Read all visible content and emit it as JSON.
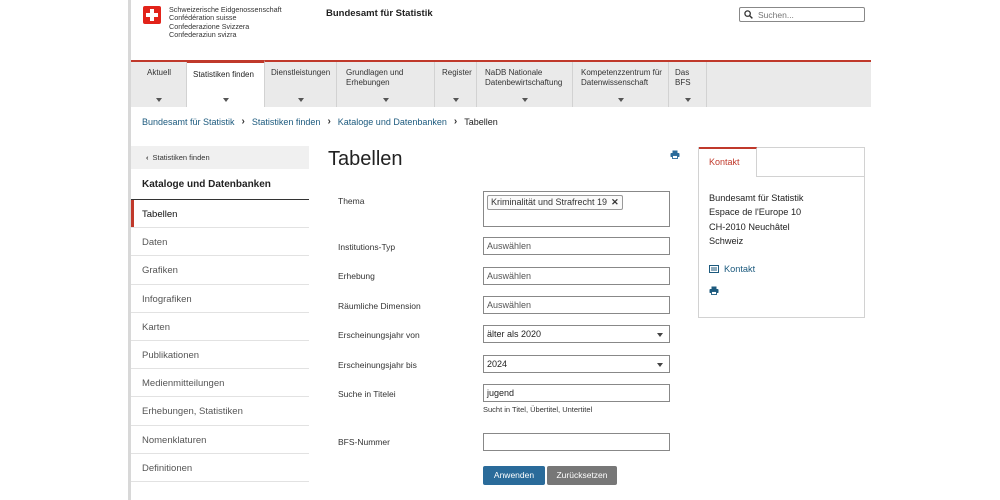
{
  "header": {
    "confederation": [
      "Schweizerische Eidgenossenschaft",
      "Confédération suisse",
      "Confederazione Svizzera",
      "Confederaziun svizra"
    ],
    "office": "Bundesamt für Statistik",
    "search_placeholder": "Suchen..."
  },
  "nav": [
    {
      "label": "Aktuell"
    },
    {
      "label": "Statistiken finden"
    },
    {
      "label": "Dienstleistungen"
    },
    {
      "label": "Grundlagen und Erhebungen"
    },
    {
      "label": "Register"
    },
    {
      "label": "NaDB Nationale Datenbewirtschaftung"
    },
    {
      "label": "Kompetenzzentrum für Datenwissenschaft"
    },
    {
      "label": "Das BFS"
    }
  ],
  "breadcrumb": [
    "Bundesamt für Statistik",
    "Statistiken finden",
    "Kataloge und Datenbanken",
    "Tabellen"
  ],
  "sidebar": {
    "back": "Statistiken finden",
    "section": "Kataloge und Datenbanken",
    "items": [
      "Tabellen",
      "Daten",
      "Grafiken",
      "Infografiken",
      "Karten",
      "Publikationen",
      "Medienmitteilungen",
      "Erhebungen, Statistiken",
      "Nomenklaturen",
      "Definitionen"
    ]
  },
  "main": {
    "title": "Tabellen",
    "form": {
      "thema_label": "Thema",
      "thema_tag": "Kriminalität und Strafrecht 19",
      "institution_label": "Institutions-Typ",
      "institution_placeholder": "Auswählen",
      "erhebung_label": "Erhebung",
      "erhebung_placeholder": "Auswählen",
      "raum_label": "Räumliche Dimension",
      "raum_placeholder": "Auswählen",
      "von_label": "Erscheinungsjahr von",
      "von_value": "älter als 2020",
      "bis_label": "Erscheinungsjahr bis",
      "bis_value": "2024",
      "titel_label": "Suche in Titelei",
      "titel_value": "jugend",
      "titel_hint": "Sucht in Titel, Übertitel, Untertitel",
      "bfs_label": "BFS-Nummer",
      "bfs_value": "",
      "apply": "Anwenden",
      "reset": "Zurücksetzen"
    }
  },
  "contact": {
    "tab": "Kontakt",
    "address": [
      "Bundesamt für Statistik",
      "Espace de l'Europe 10",
      "CH-2010 Neuchâtel",
      "Schweiz"
    ],
    "link": "Kontakt"
  },
  "colors": {
    "accent": "#c0392b",
    "link": "#1c5a7e",
    "primary_button": "#2a6b9a"
  }
}
